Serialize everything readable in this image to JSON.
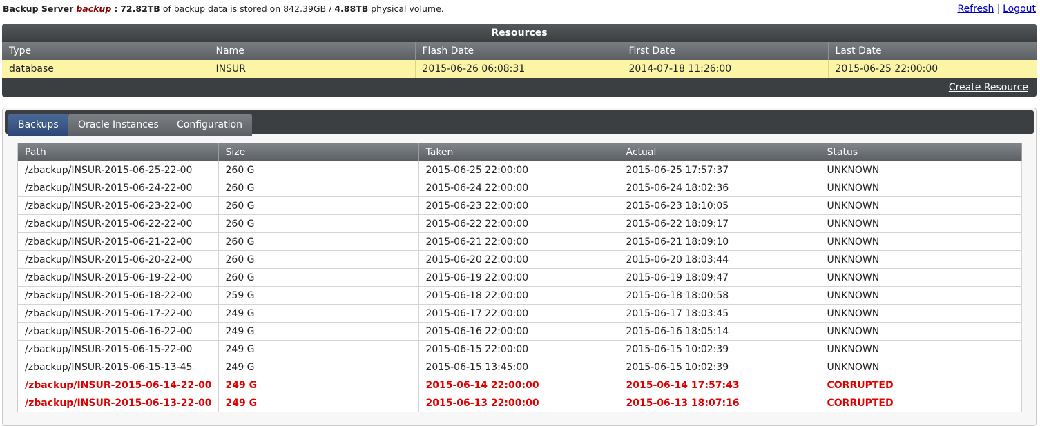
{
  "header": {
    "prefix": "Backup Server",
    "server_name": "backup",
    "colon": ":",
    "backup_size": "72.82TB",
    "mid_text": "of backup data is stored on",
    "physical_used": "842.39GB",
    "slash": "/",
    "physical_total": "4.88TB",
    "suffix": "physical volume.",
    "refresh_label": "Refresh",
    "separator": "|",
    "logout_label": "Logout"
  },
  "resources": {
    "title": "Resources",
    "columns": [
      "Type",
      "Name",
      "Flash Date",
      "First Date",
      "Last Date"
    ],
    "row": [
      "database",
      "INSUR",
      "2015-06-26 06:08:31",
      "2014-07-18 11:26:00",
      "2015-06-25 22:00:00"
    ],
    "create_label": "Create Resource"
  },
  "tabs": [
    {
      "label": "Backups",
      "active": true
    },
    {
      "label": "Oracle Instances",
      "active": false
    },
    {
      "label": "Configuration",
      "active": false
    }
  ],
  "backups": {
    "columns": [
      "Path",
      "Size",
      "Taken",
      "Actual",
      "Status"
    ],
    "rows": [
      [
        "/zbackup/INSUR-2015-06-25-22-00",
        "260 G",
        "2015-06-25 22:00:00",
        "2015-06-25 17:57:37",
        "UNKNOWN"
      ],
      [
        "/zbackup/INSUR-2015-06-24-22-00",
        "260 G",
        "2015-06-24 22:00:00",
        "2015-06-24 18:02:36",
        "UNKNOWN"
      ],
      [
        "/zbackup/INSUR-2015-06-23-22-00",
        "260 G",
        "2015-06-23 22:00:00",
        "2015-06-23 18:10:05",
        "UNKNOWN"
      ],
      [
        "/zbackup/INSUR-2015-06-22-22-00",
        "260 G",
        "2015-06-22 22:00:00",
        "2015-06-22 18:09:17",
        "UNKNOWN"
      ],
      [
        "/zbackup/INSUR-2015-06-21-22-00",
        "260 G",
        "2015-06-21 22:00:00",
        "2015-06-21 18:09:10",
        "UNKNOWN"
      ],
      [
        "/zbackup/INSUR-2015-06-20-22-00",
        "260 G",
        "2015-06-20 22:00:00",
        "2015-06-20 18:03:44",
        "UNKNOWN"
      ],
      [
        "/zbackup/INSUR-2015-06-19-22-00",
        "260 G",
        "2015-06-19 22:00:00",
        "2015-06-19 18:09:47",
        "UNKNOWN"
      ],
      [
        "/zbackup/INSUR-2015-06-18-22-00",
        "259 G",
        "2015-06-18 22:00:00",
        "2015-06-18 18:00:58",
        "UNKNOWN"
      ],
      [
        "/zbackup/INSUR-2015-06-17-22-00",
        "249 G",
        "2015-06-17 22:00:00",
        "2015-06-17 18:03:45",
        "UNKNOWN"
      ],
      [
        "/zbackup/INSUR-2015-06-16-22-00",
        "249 G",
        "2015-06-16 22:00:00",
        "2015-06-16 18:05:14",
        "UNKNOWN"
      ],
      [
        "/zbackup/INSUR-2015-06-15-22-00",
        "249 G",
        "2015-06-15 22:00:00",
        "2015-06-15 10:02:39",
        "UNKNOWN"
      ],
      [
        "/zbackup/INSUR-2015-06-15-13-45",
        "249 G",
        "2015-06-15 13:45:00",
        "2015-06-15 10:02:39",
        "UNKNOWN"
      ],
      [
        "/zbackup/INSUR-2015-06-14-22-00",
        "249 G",
        "2015-06-14 22:00:00",
        "2015-06-14 17:57:43",
        "CORRUPTED"
      ],
      [
        "/zbackup/INSUR-2015-06-13-22-00",
        "249 G",
        "2015-06-13 22:00:00",
        "2015-06-13 18:07:16",
        "CORRUPTED"
      ]
    ]
  },
  "colors": {
    "corrupted": "#e00000",
    "row_highlight": "#fdf5a6",
    "panel_dark": "#3c3f41",
    "tab_active": "#2d4775",
    "server_name": "#8b0000"
  }
}
